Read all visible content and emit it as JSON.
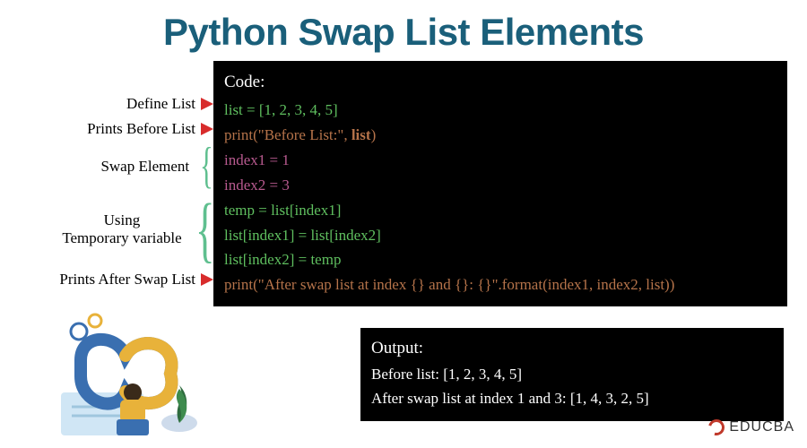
{
  "title": "Python Swap List Elements",
  "labels": {
    "define": "Define List",
    "printsBefore": "Prints Before List",
    "swap": "Swap Element",
    "usingLine1": "Using",
    "usingLine2": "Temporary variable",
    "printsAfter": "Prints After Swap List"
  },
  "code": {
    "heading": "Code:",
    "line1": "list = [1, 2, 3, 4, 5]",
    "line2a": "print(\"Before List:\", ",
    "line2b": "list",
    "line2c": ")",
    "line3": "index1 = 1",
    "line4": "index2 = 3",
    "line5": "temp = list[index1]",
    "line6": "list[index1] = list[index2]",
    "line7": "list[index2] = temp",
    "line8": "print(\"After swap list at index {} and {}: {}\".format(index1, index2, list))"
  },
  "output": {
    "heading": "Output:",
    "line1": "Before list: [1, 2, 3, 4, 5]",
    "line2": "After swap list at index  1 and 3: [1, 4, 3, 2, 5]"
  },
  "brand": "EDUCBA"
}
